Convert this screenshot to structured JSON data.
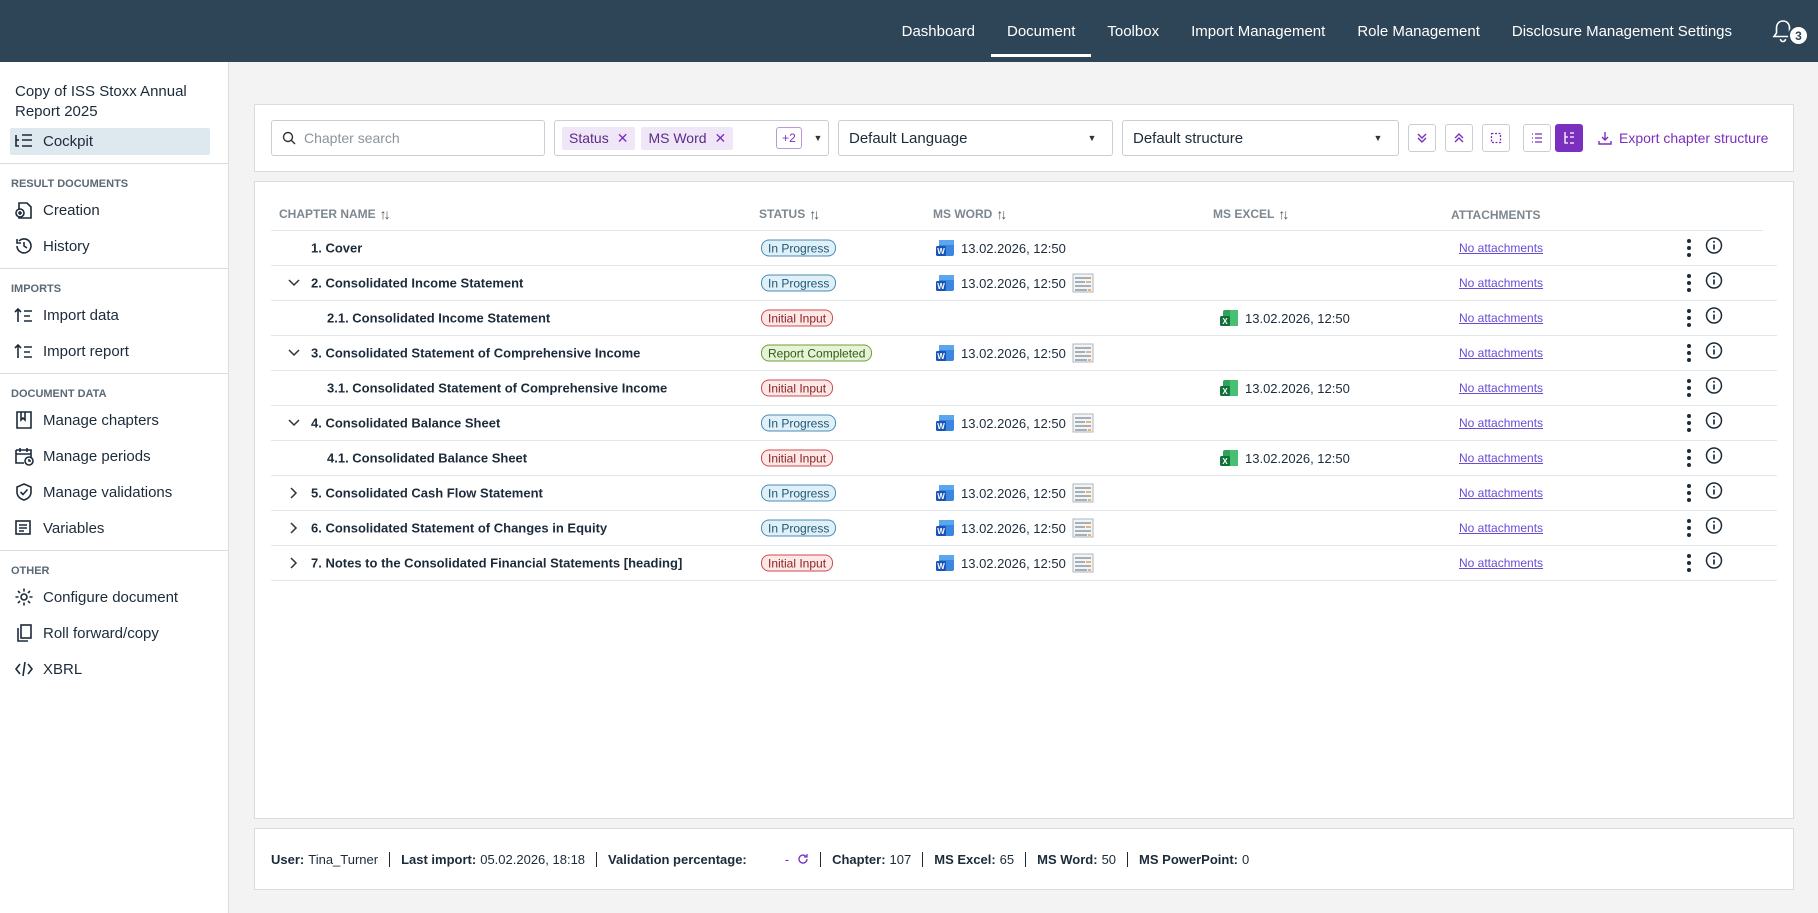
{
  "nav": {
    "items": [
      {
        "label": "Dashboard",
        "active": false
      },
      {
        "label": "Document",
        "active": true
      },
      {
        "label": "Toolbox",
        "active": false
      },
      {
        "label": "Import Management",
        "active": false
      },
      {
        "label": "Role Management",
        "active": false
      },
      {
        "label": "Disclosure Management Settings",
        "active": false
      }
    ],
    "notification_count": "3"
  },
  "sidebar": {
    "document_title": "Copy of ISS Stoxx Annual Report 2025",
    "cockpit": "Cockpit",
    "sections": {
      "result_documents": "RESULT DOCUMENTS",
      "imports": "IMPORTS",
      "document_data": "DOCUMENT DATA",
      "other": "OTHER"
    },
    "items": {
      "creation": "Creation",
      "history": "History",
      "import_data": "Import data",
      "import_report": "Import report",
      "manage_chapters": "Manage chapters",
      "manage_periods": "Manage periods",
      "manage_validations": "Manage validations",
      "variables": "Variables",
      "configure_document": "Configure document",
      "roll_forward": "Roll forward/copy",
      "xbrl": "XBRL"
    }
  },
  "toolbar": {
    "search_placeholder": "Chapter search",
    "chips": [
      "Status",
      "MS Word"
    ],
    "more_count": "+2",
    "language": "Default Language",
    "structure": "Default structure",
    "export_label": "Export chapter structure"
  },
  "table": {
    "headers": {
      "chapter_name": "CHAPTER NAME",
      "status": "STATUS",
      "ms_word": "MS WORD",
      "ms_excel": "MS EXCEL",
      "attachments": "ATTACHMENTS"
    },
    "rows": [
      {
        "name": "1. Cover",
        "status": "In Progress",
        "word": "13.02.2026, 12:50",
        "excel": "",
        "att": "No attachments"
      },
      {
        "name": "2. Consolidated Income Statement",
        "status": "In Progress",
        "word": "13.02.2026, 12:50",
        "excel": "",
        "att": "No attachments"
      },
      {
        "name": "2.1. Consolidated Income Statement",
        "status": "Initial Input",
        "word": "",
        "excel": "13.02.2026, 12:50",
        "att": "No attachments"
      },
      {
        "name": "3. Consolidated Statement of Comprehensive Income",
        "status": "Report Completed",
        "word": "13.02.2026, 12:50",
        "excel": "",
        "att": "No attachments"
      },
      {
        "name": "3.1. Consolidated Statement of Comprehensive Income",
        "status": "Initial Input",
        "word": "",
        "excel": "13.02.2026, 12:50",
        "att": "No attachments"
      },
      {
        "name": "4. Consolidated Balance Sheet",
        "status": "In Progress",
        "word": "13.02.2026, 12:50",
        "excel": "",
        "att": "No attachments"
      },
      {
        "name": "4.1. Consolidated Balance Sheet",
        "status": "Initial Input",
        "word": "",
        "excel": "13.02.2026, 12:50",
        "att": "No attachments"
      },
      {
        "name": "5. Consolidated Cash Flow Statement",
        "status": "In Progress",
        "word": "13.02.2026, 12:50",
        "excel": "",
        "att": "No attachments"
      },
      {
        "name": "6. Consolidated Statement of Changes in Equity",
        "status": "In Progress",
        "word": "13.02.2026, 12:50",
        "excel": "",
        "att": "No attachments"
      },
      {
        "name": "7. Notes to the Consolidated Financial Statements [heading]",
        "status": "Initial Input",
        "word": "13.02.2026, 12:50",
        "excel": "",
        "att": "No attachments"
      }
    ]
  },
  "statusbar": {
    "user_label": "User:",
    "user": "Tina_Turner",
    "last_import_label": "Last import:",
    "last_import": "05.02.2026, 18:18",
    "validation_label": "Validation percentage:",
    "validation": "-",
    "chapter_label": "Chapter:",
    "chapter": "107",
    "excel_label": "MS Excel:",
    "excel": "65",
    "word_label": "MS Word:",
    "word": "50",
    "ppt_label": "MS PowerPoint:",
    "ppt": "0"
  }
}
